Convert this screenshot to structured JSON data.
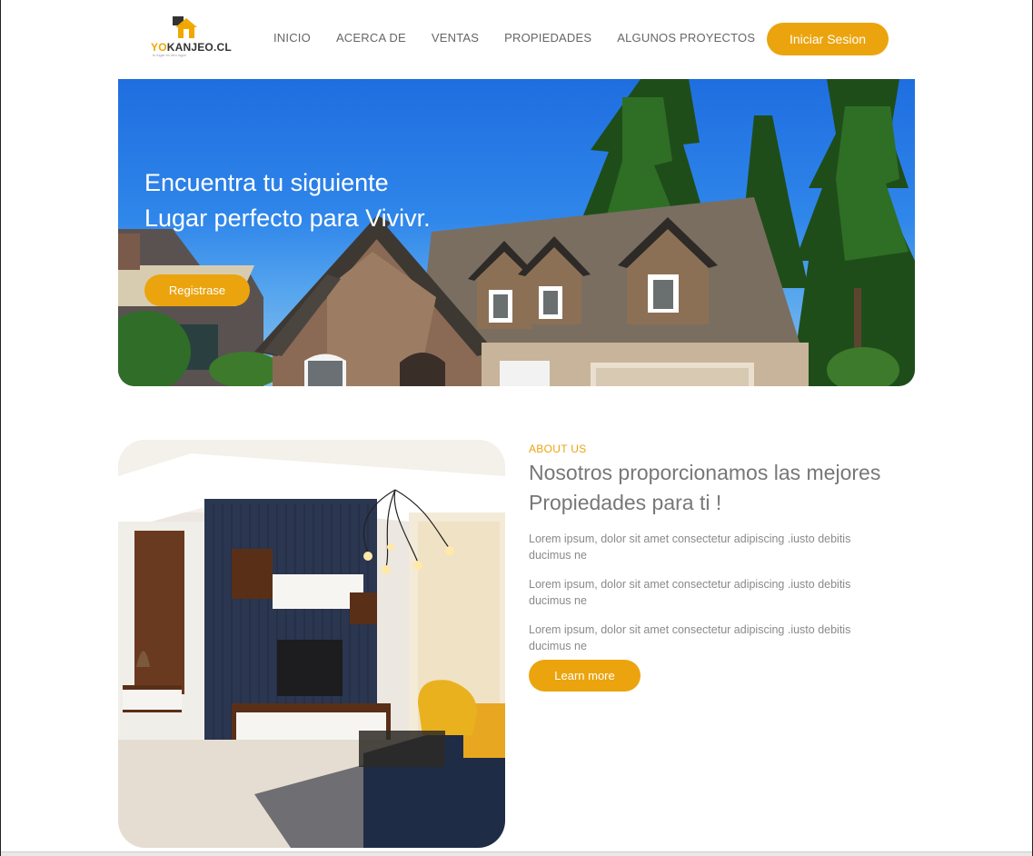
{
  "brand": {
    "name_part1": "YO",
    "name_part2": "KANJEO.CL",
    "tagline": "tu lugar en otro lugar",
    "colors": {
      "accent": "#eba40e",
      "logo_dark": "#333333"
    }
  },
  "nav": {
    "items": [
      "INICIO",
      "ACERCA DE",
      "VENTAS",
      "PROPIEDADES",
      "ALGUNOS PROYECTOS"
    ],
    "login_label": "Iniciar Sesion"
  },
  "hero": {
    "title": "Encuentra tu siguiente Lugar perfecto para Vivivr.",
    "cta_label": "Registrase"
  },
  "about": {
    "eyebrow": "ABOUT US",
    "title": "Nosotros proporcionamos las mejores Propiedades para ti !",
    "paragraphs": [
      "Lorem ipsum, dolor sit amet consectetur adipiscing .iusto debitis ducimus ne",
      "Lorem ipsum, dolor sit amet consectetur adipiscing .iusto debitis ducimus ne",
      "Lorem ipsum, dolor sit amet consectetur adipiscing .iusto debitis ducimus ne"
    ],
    "cta_label": "Learn more"
  },
  "icons": {
    "logo": "house-roof-icon"
  }
}
